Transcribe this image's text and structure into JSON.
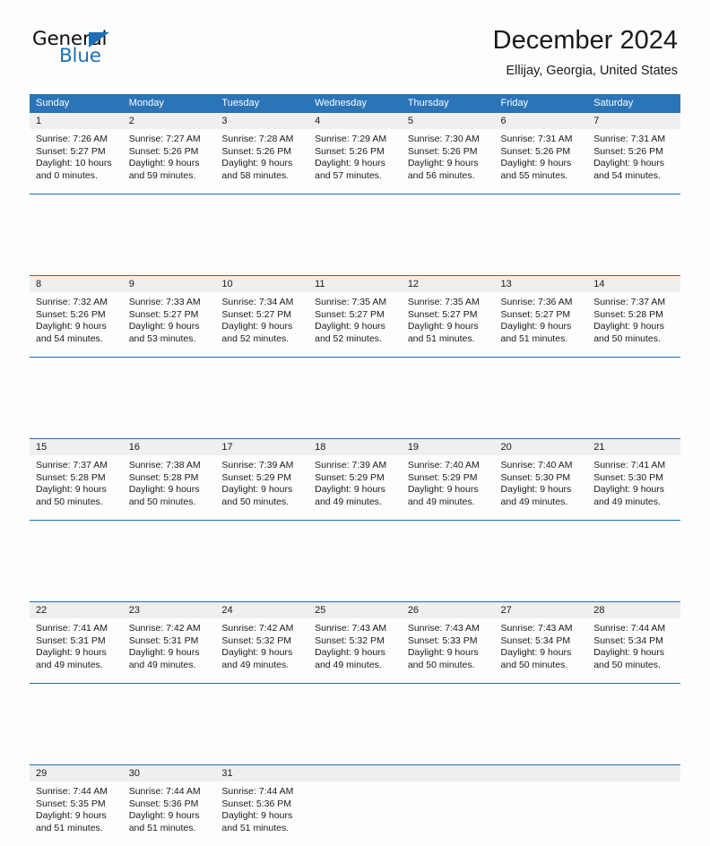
{
  "brand": {
    "name_top": "General",
    "name_bottom": "Blue",
    "accent_color": "#1f6fb4"
  },
  "header": {
    "title": "December 2024",
    "subtitle": "Ellijay, Georgia, United States"
  },
  "theme": {
    "header_bg": "#2b74b8",
    "daynum_bg": "#efefef",
    "border": "#1f6fb4",
    "page_bg": "#fdfdfd",
    "text": "#1a1a1a"
  },
  "weekday_headers": [
    "Sunday",
    "Monday",
    "Tuesday",
    "Wednesday",
    "Thursday",
    "Friday",
    "Saturday"
  ],
  "weeks": [
    [
      {
        "day": "1",
        "sunrise": "Sunrise: 7:26 AM",
        "sunset": "Sunset: 5:27 PM",
        "daylight_1": "Daylight: 10 hours",
        "daylight_2": "and 0 minutes."
      },
      {
        "day": "2",
        "sunrise": "Sunrise: 7:27 AM",
        "sunset": "Sunset: 5:26 PM",
        "daylight_1": "Daylight: 9 hours",
        "daylight_2": "and 59 minutes."
      },
      {
        "day": "3",
        "sunrise": "Sunrise: 7:28 AM",
        "sunset": "Sunset: 5:26 PM",
        "daylight_1": "Daylight: 9 hours",
        "daylight_2": "and 58 minutes."
      },
      {
        "day": "4",
        "sunrise": "Sunrise: 7:29 AM",
        "sunset": "Sunset: 5:26 PM",
        "daylight_1": "Daylight: 9 hours",
        "daylight_2": "and 57 minutes."
      },
      {
        "day": "5",
        "sunrise": "Sunrise: 7:30 AM",
        "sunset": "Sunset: 5:26 PM",
        "daylight_1": "Daylight: 9 hours",
        "daylight_2": "and 56 minutes."
      },
      {
        "day": "6",
        "sunrise": "Sunrise: 7:31 AM",
        "sunset": "Sunset: 5:26 PM",
        "daylight_1": "Daylight: 9 hours",
        "daylight_2": "and 55 minutes."
      },
      {
        "day": "7",
        "sunrise": "Sunrise: 7:31 AM",
        "sunset": "Sunset: 5:26 PM",
        "daylight_1": "Daylight: 9 hours",
        "daylight_2": "and 54 minutes."
      }
    ],
    [
      {
        "day": "8",
        "sunrise": "Sunrise: 7:32 AM",
        "sunset": "Sunset: 5:26 PM",
        "daylight_1": "Daylight: 9 hours",
        "daylight_2": "and 54 minutes."
      },
      {
        "day": "9",
        "sunrise": "Sunrise: 7:33 AM",
        "sunset": "Sunset: 5:27 PM",
        "daylight_1": "Daylight: 9 hours",
        "daylight_2": "and 53 minutes."
      },
      {
        "day": "10",
        "sunrise": "Sunrise: 7:34 AM",
        "sunset": "Sunset: 5:27 PM",
        "daylight_1": "Daylight: 9 hours",
        "daylight_2": "and 52 minutes."
      },
      {
        "day": "11",
        "sunrise": "Sunrise: 7:35 AM",
        "sunset": "Sunset: 5:27 PM",
        "daylight_1": "Daylight: 9 hours",
        "daylight_2": "and 52 minutes."
      },
      {
        "day": "12",
        "sunrise": "Sunrise: 7:35 AM",
        "sunset": "Sunset: 5:27 PM",
        "daylight_1": "Daylight: 9 hours",
        "daylight_2": "and 51 minutes."
      },
      {
        "day": "13",
        "sunrise": "Sunrise: 7:36 AM",
        "sunset": "Sunset: 5:27 PM",
        "daylight_1": "Daylight: 9 hours",
        "daylight_2": "and 51 minutes."
      },
      {
        "day": "14",
        "sunrise": "Sunrise: 7:37 AM",
        "sunset": "Sunset: 5:28 PM",
        "daylight_1": "Daylight: 9 hours",
        "daylight_2": "and 50 minutes."
      }
    ],
    [
      {
        "day": "15",
        "sunrise": "Sunrise: 7:37 AM",
        "sunset": "Sunset: 5:28 PM",
        "daylight_1": "Daylight: 9 hours",
        "daylight_2": "and 50 minutes."
      },
      {
        "day": "16",
        "sunrise": "Sunrise: 7:38 AM",
        "sunset": "Sunset: 5:28 PM",
        "daylight_1": "Daylight: 9 hours",
        "daylight_2": "and 50 minutes."
      },
      {
        "day": "17",
        "sunrise": "Sunrise: 7:39 AM",
        "sunset": "Sunset: 5:29 PM",
        "daylight_1": "Daylight: 9 hours",
        "daylight_2": "and 50 minutes."
      },
      {
        "day": "18",
        "sunrise": "Sunrise: 7:39 AM",
        "sunset": "Sunset: 5:29 PM",
        "daylight_1": "Daylight: 9 hours",
        "daylight_2": "and 49 minutes."
      },
      {
        "day": "19",
        "sunrise": "Sunrise: 7:40 AM",
        "sunset": "Sunset: 5:29 PM",
        "daylight_1": "Daylight: 9 hours",
        "daylight_2": "and 49 minutes."
      },
      {
        "day": "20",
        "sunrise": "Sunrise: 7:40 AM",
        "sunset": "Sunset: 5:30 PM",
        "daylight_1": "Daylight: 9 hours",
        "daylight_2": "and 49 minutes."
      },
      {
        "day": "21",
        "sunrise": "Sunrise: 7:41 AM",
        "sunset": "Sunset: 5:30 PM",
        "daylight_1": "Daylight: 9 hours",
        "daylight_2": "and 49 minutes."
      }
    ],
    [
      {
        "day": "22",
        "sunrise": "Sunrise: 7:41 AM",
        "sunset": "Sunset: 5:31 PM",
        "daylight_1": "Daylight: 9 hours",
        "daylight_2": "and 49 minutes."
      },
      {
        "day": "23",
        "sunrise": "Sunrise: 7:42 AM",
        "sunset": "Sunset: 5:31 PM",
        "daylight_1": "Daylight: 9 hours",
        "daylight_2": "and 49 minutes."
      },
      {
        "day": "24",
        "sunrise": "Sunrise: 7:42 AM",
        "sunset": "Sunset: 5:32 PM",
        "daylight_1": "Daylight: 9 hours",
        "daylight_2": "and 49 minutes."
      },
      {
        "day": "25",
        "sunrise": "Sunrise: 7:43 AM",
        "sunset": "Sunset: 5:32 PM",
        "daylight_1": "Daylight: 9 hours",
        "daylight_2": "and 49 minutes."
      },
      {
        "day": "26",
        "sunrise": "Sunrise: 7:43 AM",
        "sunset": "Sunset: 5:33 PM",
        "daylight_1": "Daylight: 9 hours",
        "daylight_2": "and 50 minutes."
      },
      {
        "day": "27",
        "sunrise": "Sunrise: 7:43 AM",
        "sunset": "Sunset: 5:34 PM",
        "daylight_1": "Daylight: 9 hours",
        "daylight_2": "and 50 minutes."
      },
      {
        "day": "28",
        "sunrise": "Sunrise: 7:44 AM",
        "sunset": "Sunset: 5:34 PM",
        "daylight_1": "Daylight: 9 hours",
        "daylight_2": "and 50 minutes."
      }
    ],
    [
      {
        "day": "29",
        "sunrise": "Sunrise: 7:44 AM",
        "sunset": "Sunset: 5:35 PM",
        "daylight_1": "Daylight: 9 hours",
        "daylight_2": "and 51 minutes."
      },
      {
        "day": "30",
        "sunrise": "Sunrise: 7:44 AM",
        "sunset": "Sunset: 5:36 PM",
        "daylight_1": "Daylight: 9 hours",
        "daylight_2": "and 51 minutes."
      },
      {
        "day": "31",
        "sunrise": "Sunrise: 7:44 AM",
        "sunset": "Sunset: 5:36 PM",
        "daylight_1": "Daylight: 9 hours",
        "daylight_2": "and 51 minutes."
      },
      {
        "day": "",
        "sunrise": "",
        "sunset": "",
        "daylight_1": "",
        "daylight_2": ""
      },
      {
        "day": "",
        "sunrise": "",
        "sunset": "",
        "daylight_1": "",
        "daylight_2": ""
      },
      {
        "day": "",
        "sunrise": "",
        "sunset": "",
        "daylight_1": "",
        "daylight_2": ""
      },
      {
        "day": "",
        "sunrise": "",
        "sunset": "",
        "daylight_1": "",
        "daylight_2": ""
      }
    ]
  ]
}
